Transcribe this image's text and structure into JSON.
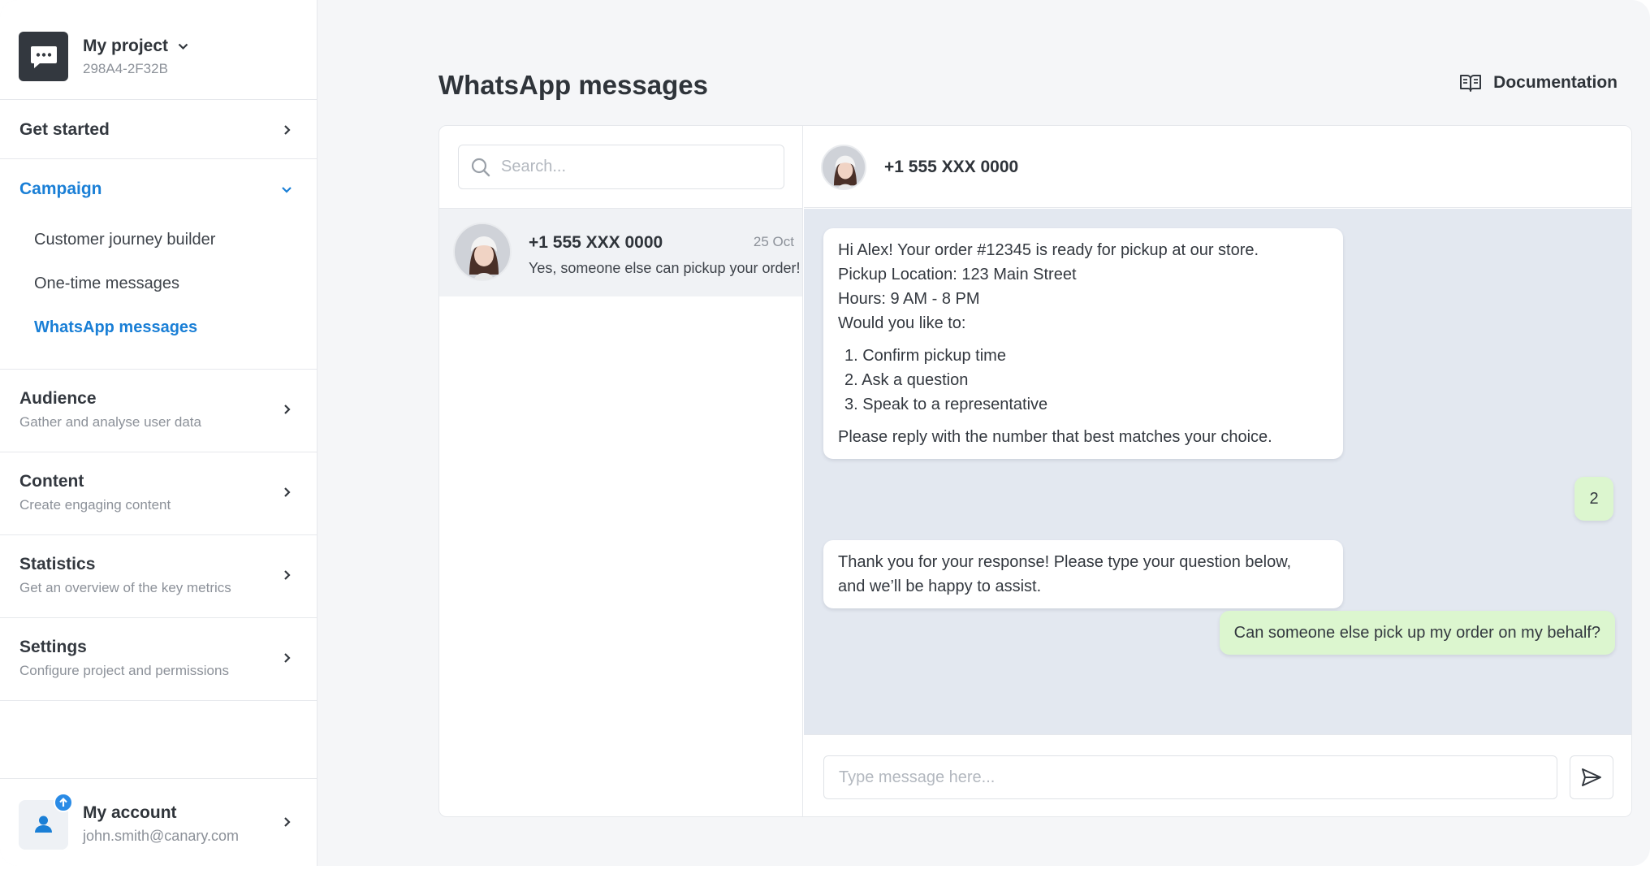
{
  "project": {
    "name": "My project",
    "id": "298A4-2F32B"
  },
  "nav": {
    "get_started": "Get started",
    "campaign": {
      "title": "Campaign",
      "items": [
        "Customer journey builder",
        "One-time messages",
        "WhatsApp messages"
      ]
    },
    "audience": {
      "title": "Audience",
      "subtitle": "Gather and analyse user data"
    },
    "content": {
      "title": "Content",
      "subtitle": "Create engaging content"
    },
    "statistics": {
      "title": "Statistics",
      "subtitle": "Get an overview of the key metrics"
    },
    "settings": {
      "title": "Settings",
      "subtitle": "Configure project and permissions"
    }
  },
  "account": {
    "name": "My account",
    "email": "john.smith@canary.com"
  },
  "page": {
    "title": "WhatsApp messages",
    "doc_link": "Documentation"
  },
  "search": {
    "placeholder": "Search..."
  },
  "conversations": [
    {
      "name": "+1 555 XXX 0000",
      "date": "25 Oct",
      "preview": "Yes, someone else can pickup your order!"
    }
  ],
  "chat": {
    "contact": "+1 555 XXX 0000",
    "messages": {
      "m1": {
        "lines": [
          "Hi Alex! Your order #12345 is ready for pickup at our store.",
          "Pickup Location: 123 Main Street",
          "Hours: 9 AM - 8 PM",
          "Would you like to:"
        ],
        "options": [
          "1.  Confirm pickup time",
          "2.  Ask a question",
          "3.  Speak to a representative"
        ],
        "footer": "Please reply with the number that best matches your choice."
      },
      "m2": "2",
      "m3": [
        "Thank you for your response! Please type your question below,",
        "and we’ll be happy to assist."
      ],
      "m4": "Can someone else pick up my order on my behalf?"
    },
    "input_placeholder": "Type message here..."
  },
  "colors": {
    "accent": "#1a7fd6",
    "outgoing_bubble": "#dcf6cf",
    "chat_bg": "#e3e8f0"
  }
}
